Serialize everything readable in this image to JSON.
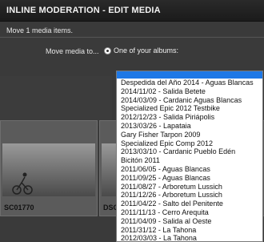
{
  "header": {
    "title": "INLINE MODERATION - EDIT MEDIA"
  },
  "info": {
    "subline": "Move 1 media items."
  },
  "form": {
    "move_label": "Move media to...",
    "option_albums_label": "One of your albums:"
  },
  "thumbnails": [
    {
      "caption": "SC01770"
    },
    {
      "caption": "DSC"
    }
  ],
  "dropdown": {
    "selected": "",
    "options": [
      "Despedida del Año 2014 - Aguas Blancas",
      "2014/11/02 - Salida Betete",
      "2014/03/09 - Cardanic Aguas Blancas",
      "Specialized Epic 2012 Testbike",
      "2012/12/23 - Salida Piriápolis",
      "2013/03/26 - Lapataia",
      "Gary Fisher Tarpon 2009",
      "Specialized Epic Comp 2012",
      "2013/03/10 - Cardanic Pueblo Edén",
      "Bicitón 2011",
      "2011/06/05 - Aguas Blancas",
      "2011/09/25 - Aguas Blancas",
      "2011/08/27 - Arboretum Lussich",
      "2011/12/26 - Arboretum Lussich",
      "2011/04/22 - Salto del Penitente",
      "2011/11/13 - Cerro Arequita",
      "2011/04/09 - Salida al Oeste",
      "2011/31/12 - La Tahona",
      "2012/03/03 - La Tahona"
    ]
  },
  "colors": {
    "selection": "#1e78e6",
    "accent_button": "#3fae36"
  }
}
